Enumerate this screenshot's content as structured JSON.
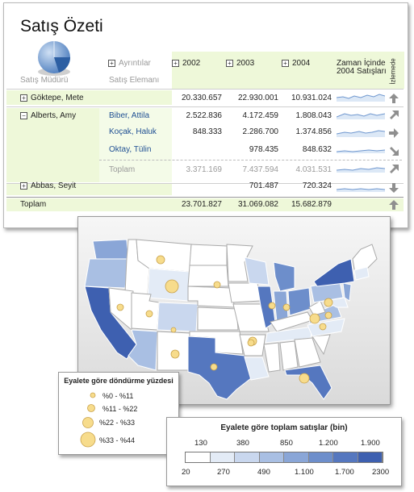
{
  "report": {
    "title": "Satış Özeti",
    "headers": {
      "manager": "Satış Müdürü",
      "details": "Ayrıntılar",
      "salesperson": "Satış Elemanı",
      "y2002": "2002",
      "y2003": "2003",
      "y2004": "2004",
      "trend": "Zaman İçinde 2004 Satışları",
      "tracking": "İzlemede"
    },
    "rows": [
      {
        "manager": "Göktepe, Mete",
        "salesperson": "",
        "v2002": "20.330.657",
        "v2003": "22.930.001",
        "v2004": "10.931.024"
      },
      {
        "manager": "Alberts, Amy",
        "salesperson": "Biber, Attila",
        "v2002": "2.522.836",
        "v2003": "4.172.459",
        "v2004": "1.808.043"
      },
      {
        "manager": "",
        "salesperson": "Koçak, Haluk",
        "v2002": "848.333",
        "v2003": "2.286.700",
        "v2004": "1.374.856"
      },
      {
        "manager": "",
        "salesperson": "Oktay, Tülin",
        "v2002": "",
        "v2003": "978.435",
        "v2004": "848.632"
      },
      {
        "manager": "",
        "salesperson": "Toplam",
        "v2002": "3.371.169",
        "v2003": "7.437.594",
        "v2004": "4.031.531"
      },
      {
        "manager": "Abbas, Seyit",
        "salesperson": "",
        "v2002": "",
        "v2003": "701.487",
        "v2004": "720.324"
      }
    ],
    "total": {
      "label": "Toplam",
      "v2002": "23.701.827",
      "v2003": "31.069.082",
      "v2004": "15.682.879"
    }
  },
  "map": {
    "bubble_legend": {
      "title": "Eyalete göre döndürme yüzdesi",
      "items": [
        "%0 - %11",
        "%11 - %22",
        "%22 - %33",
        "%33 - %44"
      ]
    },
    "color_legend": {
      "title": "Eyalete göre toplam satışlar (bin)",
      "top_labels": [
        "130",
        "380",
        "850",
        "1.200",
        "1.900"
      ],
      "bottom_labels": [
        "20",
        "270",
        "490",
        "1.100",
        "1.700",
        "2300"
      ],
      "colors": [
        "#ffffff",
        "#e3ebf6",
        "#c9d7ee",
        "#a9bfe3",
        "#8aa6d7",
        "#6d8ecb",
        "#5577bf",
        "#3e60b0"
      ]
    }
  }
}
